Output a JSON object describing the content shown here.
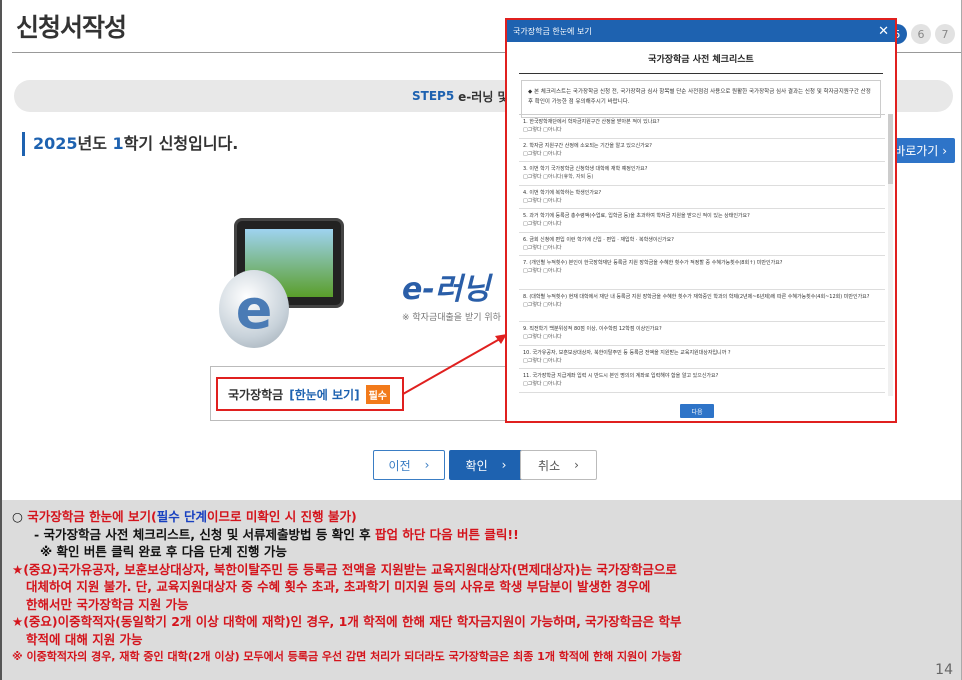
{
  "title": "신청서작성",
  "steps": [
    "5",
    "6",
    "7"
  ],
  "stepbar": {
    "step": "STEP5",
    "label": "e-러닝 및"
  },
  "semester": {
    "year": "2025",
    "year_suffix": "년도 ",
    "term": "1",
    "term_suffix": "학기 신청입니다."
  },
  "goto_button": "바로가기",
  "elearning": {
    "title": "e-러닝 이",
    "sub": "※ 학자금대출을 받기 위하",
    "egg": "e"
  },
  "link": {
    "part1": "국가장학금",
    "part2": "[한눈에 보기]",
    "badge": "필수"
  },
  "buttons": {
    "prev": "이전",
    "ok": "확인",
    "cancel": "취소"
  },
  "modal": {
    "header": "국가장학금 한눈에 보기",
    "close": "✕",
    "title": "국가장학금 사전 체크리스트",
    "notice": "◆ 본 체크리스트는 국가장학금 신청 전, 국가장학금 심사 항목별 단순 사전점검 사용으로 원활한 국가장학금 심사 결과는 신청 및 학자금지원구간 산정 후 확인이 가능한 점 유의해주시기 바랍니다.",
    "questions": [
      {
        "q": "1. 한국장학재단에서 학자금지원구간 산정을 받아본 적이 있나요?",
        "o": "□그렇다 □아니다"
      },
      {
        "q": "2. 학자금 지원구간 산정에 소요되는 기간을 알고 있으신가요?",
        "o": "□그렇다 □아니다"
      },
      {
        "q": "3. 이번 학기 국가장학금 신청학생 대학에 재학 예정인가요?",
        "o": "□그렇다 □아니다(휴학, 자퇴 등)"
      },
      {
        "q": "4. 이번 학기에 복학하는 학생인가요?",
        "o": "□그렇다 □아니다"
      },
      {
        "q": "5. 과거 학기에 등록금 총수령액(수업료, 입학금 등)을 초과하여 학자금 지원을 받으신 적이 있는 상태인가요?",
        "o": "□그렇다 □아니다"
      },
      {
        "q": "6. 금회 신청에 편입 이런 학기에 신입 · 편입 · 재입학 · 복학생이신가요?",
        "o": "□그렇다 □아니다"
      },
      {
        "q": "7. (개인별 누적횟수) 본인이 한국장학재단 등록금 지원 장학금을 수혜한 횟수가 적정할 중 수혜가능횟수(8회↑) 미만인가요?",
        "o": "□그렇다 □아니다"
      },
      {
        "q": "8. (대학별 누적횟수) 현재 대학에서 재단 내 등록금 지원 장학금을 수혜한 횟수가 재학중인 학과의 학제(2년제~6년제)에 따른 수혜가능횟수(4회~12회) 미만인가요?",
        "o": "□그렇다 □아니다"
      },
      {
        "q": "9. 직전학기 백분위성적 80점 이상, 이수학점 12학점 이상인가요?",
        "o": "□그렇다 □아니다"
      },
      {
        "q": "10. 국가유공자, 보훈보상대상자, 북한이탈주민 등 등록금 전액을 지원받는 교육지원대상자입니까 ?",
        "o": "□그렇다 □아니다"
      },
      {
        "q": "11. 국가장학금 지급계좌 입력 시 반드시 본인 명의의 계좌로 입력해야 함을 알고 있으신가요?",
        "o": "□그렇다 □아니다"
      }
    ],
    "button": "다음"
  },
  "notes": {
    "l1_bullet": "○ ",
    "l1_a": "국가장학금 한눈에 보기(",
    "l1_b": "필수 단계",
    "l1_c": "이므로 미확인 시 진행 불가)",
    "l2_a": "- 국가장학금 사전 체크리스트, 신청 및 서류제출방법 등 확인 후 ",
    "l2_b": "팝업 하단 다음 버튼 클릭!!",
    "l3": "※ 확인 버튼 클릭 완료 후 다음 단계 진행 가능",
    "l4": "★(중요)국가유공자, 보훈보상대상자, 북한이탈주민 등 등록금 전액을 지원받는 교육지원대상자(면제대상자)는 국가장학금으로",
    "l5": "대체하여 지원 불가. 단, 교육지원대상자 중 수혜 횟수 초과, 초과학기 미지원 등의 사유로 학생 부담분이 발생한 경우에",
    "l6": "한해서만 국가장학금 지원 가능",
    "l7": "★(중요)이중학적자(동일학기 2개 이상 대학에 재학)인 경우, 1개 학적에 한해 재단 학자금지원이 가능하며, 국가장학금은 학부",
    "l8": "학적에 대해 지원 가능",
    "l9": "※ 이중학적자의 경우, 재학 중인 대학(2개 이상) 모두에서 등록금 우선 감면 처리가 되더라도 국가장학금은 최종 1개 학적에 한해 지원이 가능함"
  },
  "page_number": "14"
}
